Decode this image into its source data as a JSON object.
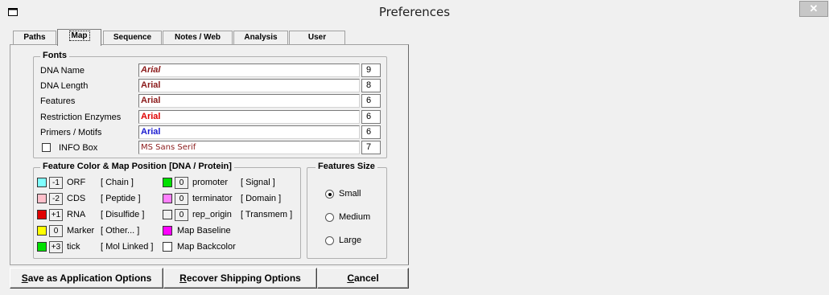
{
  "window": {
    "title": "Preferences",
    "close_glyph": "✕"
  },
  "tabs": [
    {
      "label": "Paths"
    },
    {
      "label": "Map",
      "active": true
    },
    {
      "label": "Sequence"
    },
    {
      "label": "Notes / Web"
    },
    {
      "label": "Analysis"
    },
    {
      "label": "User"
    }
  ],
  "fonts": {
    "legend": "Fonts",
    "rows": [
      {
        "label": "DNA Name",
        "font": "Arial",
        "size": "9",
        "color": "#8b1a1a",
        "italic": true
      },
      {
        "label": "DNA Length",
        "font": "Arial",
        "size": "8",
        "color": "#8b1a1a"
      },
      {
        "label": "Features",
        "font": "Arial",
        "size": "6",
        "color": "#8b1a1a"
      },
      {
        "label": "Restriction Enzymes",
        "font": "Arial",
        "size": "6",
        "color": "#e00000"
      },
      {
        "label": "Primers / Motifs",
        "font": "Arial",
        "size": "6",
        "color": "#1a1ad0"
      },
      {
        "label": "INFO Box",
        "font": "MS Sans Serif",
        "size": "7",
        "color": "#8b1a1a",
        "checkbox": true,
        "checked": false
      }
    ]
  },
  "feature_colors": {
    "legend": "Feature Color & Map Position [DNA / Protein]",
    "left": [
      {
        "swatch": "#80ffff",
        "pos": "-1",
        "name": "ORF",
        "protein": "[ Chain ]"
      },
      {
        "swatch": "#ffc0cb",
        "pos": "-2",
        "name": "CDS",
        "protein": "[ Peptide ]"
      },
      {
        "swatch": "#e00000",
        "pos": "+1",
        "name": "RNA",
        "protein": "[ Disulfide ]"
      },
      {
        "swatch": "#ffff00",
        "pos": "0",
        "name": "Marker",
        "protein": "[ Other... ]"
      },
      {
        "swatch": "#00e000",
        "pos": "+3",
        "name": "tick",
        "protein": "[ Mol Linked ]"
      }
    ],
    "right": [
      {
        "swatch": "#00e000",
        "pos": "0",
        "name": "promoter",
        "protein": "[ Signal ]"
      },
      {
        "swatch": "#ff80ff",
        "pos": "0",
        "name": "terminator",
        "protein": "[ Domain ]"
      },
      {
        "swatch": "#f0f0f0",
        "pos": "0",
        "name": "rep_origin",
        "protein": "[ Transmem ]"
      }
    ],
    "map_baseline": {
      "label": "Map Baseline",
      "swatch": "#ff00ff"
    },
    "map_backcolor": {
      "label": "Map Backcolor",
      "swatch": "#ffffff"
    }
  },
  "features_size": {
    "legend": "Features Size",
    "options": [
      {
        "label": "Small",
        "selected": true
      },
      {
        "label": "Medium",
        "selected": false
      },
      {
        "label": "Large",
        "selected": false
      }
    ]
  },
  "buttons": {
    "save": {
      "first": "S",
      "rest": "ave as Application Options"
    },
    "recover": {
      "first": "R",
      "rest": "ecover Shipping Options"
    },
    "cancel": {
      "first": "C",
      "rest": "ancel"
    }
  }
}
